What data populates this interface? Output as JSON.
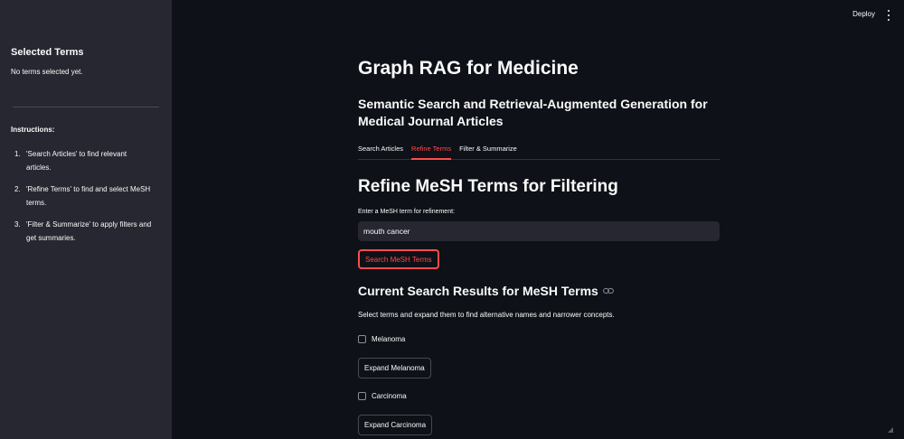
{
  "header": {
    "deploy_label": "Deploy",
    "menu_icon": "kebab-menu-icon"
  },
  "sidebar": {
    "title": "Selected Terms",
    "empty_text": "No terms selected yet.",
    "instructions_title": "Instructions:",
    "instructions": [
      {
        "num": "1.",
        "text": "'Search Articles' to find relevant articles."
      },
      {
        "num": "2.",
        "text": "'Refine Terms' to find and select MeSH terms."
      },
      {
        "num": "3.",
        "text": "'Filter & Summarize' to apply filters and get summaries."
      }
    ]
  },
  "main": {
    "title": "Graph RAG for Medicine",
    "subtitle": "Semantic Search and Retrieval-Augmented Generation for Medical Journal Articles",
    "tabs": [
      {
        "label": "Search Articles",
        "active": false
      },
      {
        "label": "Refine Terms",
        "active": true
      },
      {
        "label": "Filter & Summarize",
        "active": false
      }
    ],
    "section_title": "Refine MeSH Terms for Filtering",
    "input_label": "Enter a MeSH term for refinement:",
    "input_value": "mouth cancer",
    "search_button": "Search MeSH Terms",
    "results_title": "Current Search Results for MeSH Terms",
    "results_desc": "Select terms and expand them to find alternative names and narrower concepts.",
    "results": [
      {
        "term": "Melanoma",
        "checked": false,
        "expand_label": "Expand Melanoma"
      },
      {
        "term": "Carcinoma",
        "checked": false,
        "expand_label": "Expand Carcinoma"
      }
    ]
  },
  "colors": {
    "accent": "#ff4b4b",
    "background": "#0e1117",
    "sidebar": "#262730"
  }
}
